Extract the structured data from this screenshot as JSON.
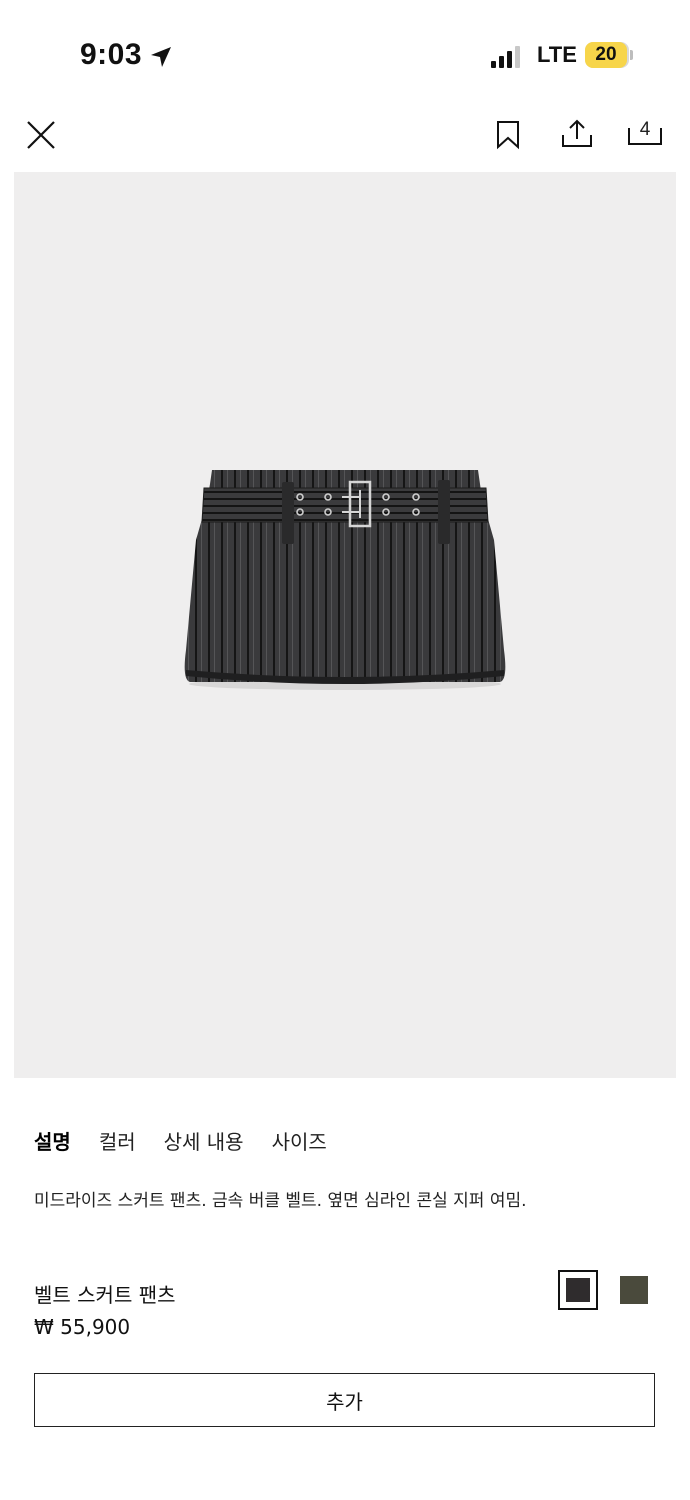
{
  "status": {
    "time": "9:03",
    "network": "LTE",
    "battery": "20",
    "icons": [
      "location-arrow-icon",
      "signal-bars-icon",
      "battery-icon"
    ]
  },
  "topbar": {
    "icons": [
      "close-icon",
      "bookmark-icon",
      "share-icon",
      "cart-icon"
    ],
    "cart_count": "4"
  },
  "tabs": [
    {
      "label": "설명",
      "active": true
    },
    {
      "label": "컬러",
      "active": false
    },
    {
      "label": "상세 내용",
      "active": false
    },
    {
      "label": "사이즈",
      "active": false
    }
  ],
  "product": {
    "description": "미드라이즈 스커트 팬츠. 금속 버클 벨트. 옆면 심라인 콘실 지퍼 여밈.",
    "name": "벨트 스커트 팬츠",
    "price": "₩ 55,900",
    "colors": [
      {
        "hex": "#2f2c2d",
        "selected": true
      },
      {
        "hex": "#4a4a3c",
        "selected": false
      }
    ]
  },
  "actions": {
    "add_label": "추가"
  },
  "colors": {
    "image_bg": "#efeeee",
    "battery": "#f7d54a"
  }
}
